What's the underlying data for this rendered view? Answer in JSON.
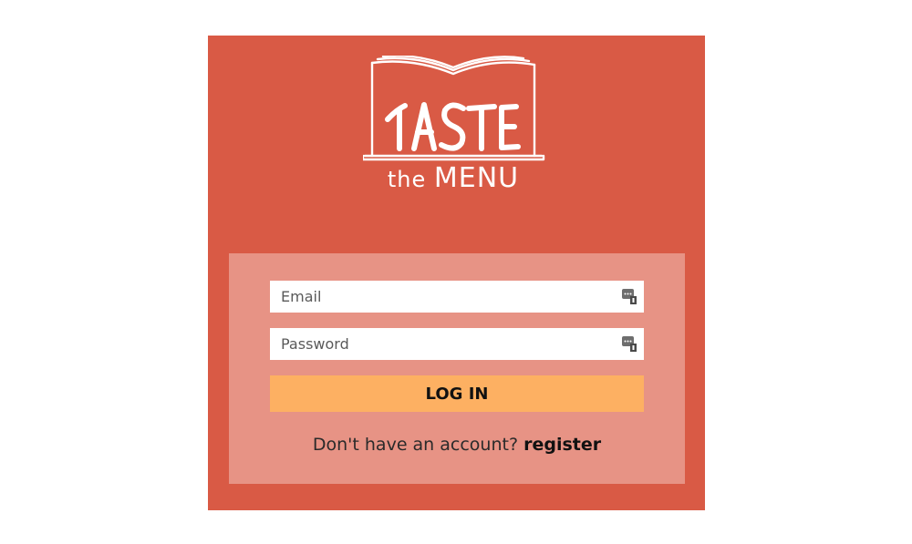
{
  "brand": {
    "logo_word": "TASTE",
    "logo_subtitle": "the MENU"
  },
  "colors": {
    "card_background": "#d95a45",
    "panel_background": "#e79385",
    "button_background": "#fdb062"
  },
  "form": {
    "email": {
      "placeholder": "Email",
      "value": "",
      "icon": "password-manager-key-icon"
    },
    "password": {
      "placeholder": "Password",
      "value": "",
      "icon": "password-manager-key-icon"
    },
    "login_label": "LOG IN",
    "register_prompt": "Don't have an account?",
    "register_link": "register"
  }
}
